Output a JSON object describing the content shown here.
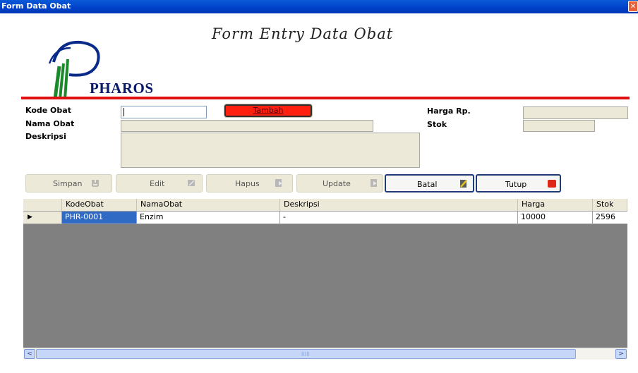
{
  "window": {
    "title": "Form Data Obat",
    "close_glyph": "✕"
  },
  "header": {
    "heading": "Form Entry Data Obat",
    "logo_text": "PHAROS",
    "accent_color": "#e01010"
  },
  "form": {
    "kode_label": "Kode Obat",
    "nama_label": "Nama Obat",
    "deskripsi_label": "Deskripsi",
    "harga_label": "Harga Rp.",
    "stok_label": "Stok",
    "kode_value": "",
    "nama_value": "",
    "deskripsi_value": "",
    "harga_value": "",
    "stok_value": "",
    "tambah_label": "Tambah"
  },
  "toolbar": {
    "simpan": "Simpan",
    "edit": "Edit",
    "hapus": "Hapus",
    "update": "Update",
    "batal": "Batal",
    "tutup": "Tutup"
  },
  "grid": {
    "columns": [
      "KodeObat",
      "NamaObat",
      "Deskripsi",
      "Harga",
      "Stok"
    ],
    "rows": [
      {
        "indicator": "▶",
        "kode": "PHR-0001",
        "nama": "Enzim",
        "deskripsi": "-",
        "harga": "10000",
        "stok": "2596"
      }
    ]
  },
  "scrollbar": {
    "left_arrow": "<",
    "right_arrow": ">",
    "grip": "IIIII"
  }
}
